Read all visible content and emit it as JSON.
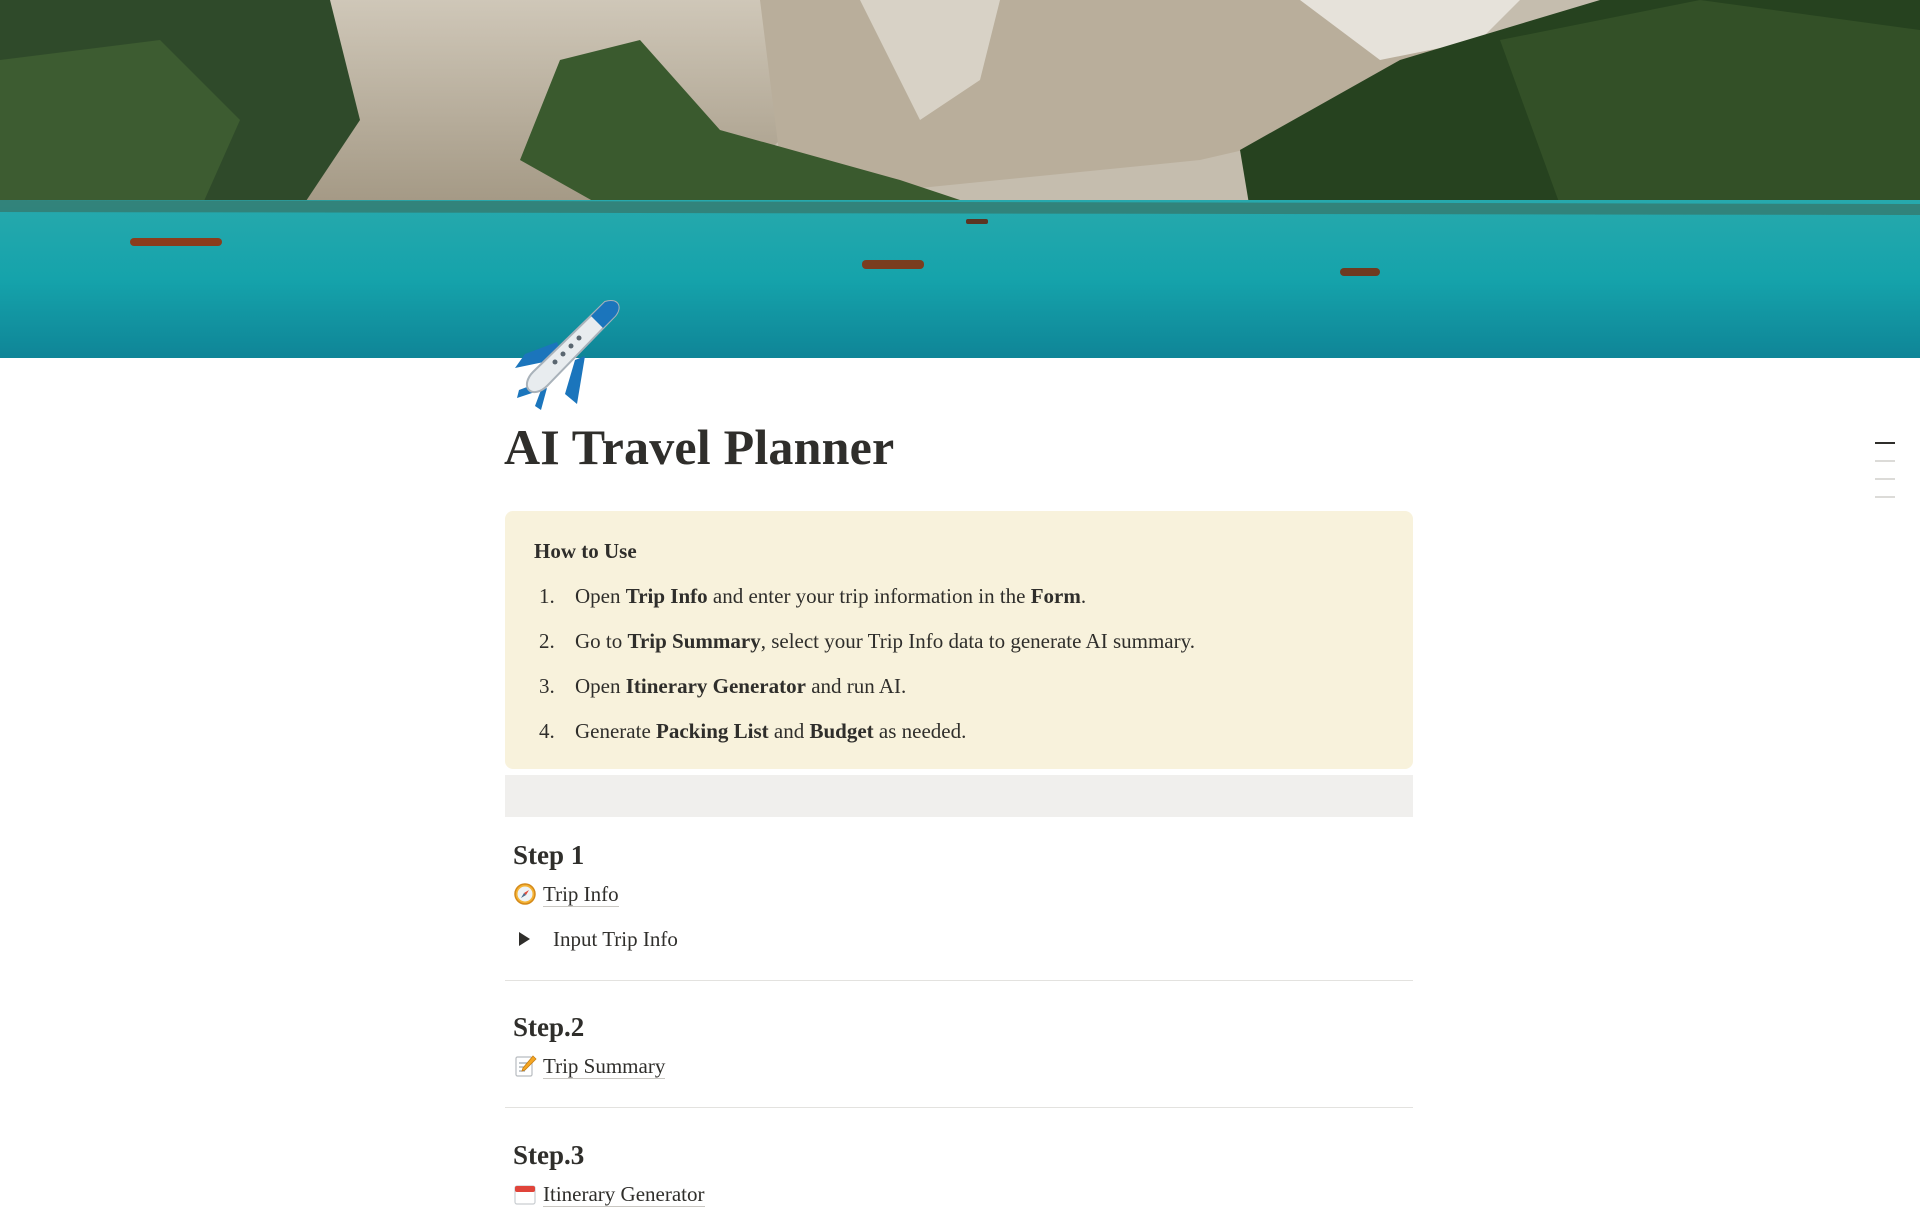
{
  "page": {
    "title": "AI Travel Planner",
    "icon": "airplane-icon",
    "cover": "mountain-lake-photo"
  },
  "callout": {
    "title": "How to Use",
    "steps": [
      {
        "num": "1.",
        "parts": [
          {
            "t": "Open ",
            "b": false
          },
          {
            "t": "Trip Info",
            "b": true
          },
          {
            "t": " and enter your trip information in the ",
            "b": false
          },
          {
            "t": "Form",
            "b": true
          },
          {
            "t": ".",
            "b": false
          }
        ]
      },
      {
        "num": "2.",
        "parts": [
          {
            "t": "Go to ",
            "b": false
          },
          {
            "t": "Trip Summary",
            "b": true
          },
          {
            "t": ", select your Trip Info data to generate AI summary.",
            "b": false
          }
        ]
      },
      {
        "num": "3.",
        "parts": [
          {
            "t": "Open ",
            "b": false
          },
          {
            "t": "Itinerary Generator",
            "b": true
          },
          {
            "t": " and run AI.",
            "b": false
          }
        ]
      },
      {
        "num": "4.",
        "parts": [
          {
            "t": "Generate ",
            "b": false
          },
          {
            "t": "Packing List",
            "b": true
          },
          {
            "t": " and ",
            "b": false
          },
          {
            "t": "Budget",
            "b": true
          },
          {
            "t": " as needed.",
            "b": false
          }
        ]
      }
    ]
  },
  "sections": {
    "step1": {
      "heading": "Step 1",
      "link": {
        "label": "Trip Info",
        "icon": "compass-icon"
      },
      "toggle": {
        "label": "Input Trip Info"
      }
    },
    "step2": {
      "heading": "Step.2",
      "link": {
        "label": "Trip Summary",
        "icon": "memo-icon"
      }
    },
    "step3": {
      "heading": "Step.3",
      "link": {
        "label": "Itinerary Generator",
        "icon": "calendar-icon"
      }
    }
  },
  "colors": {
    "callout_bg": "#f8f2dc",
    "text": "#2f2e2b",
    "divider": "#e3e2df",
    "gray_block": "#f0efed"
  }
}
